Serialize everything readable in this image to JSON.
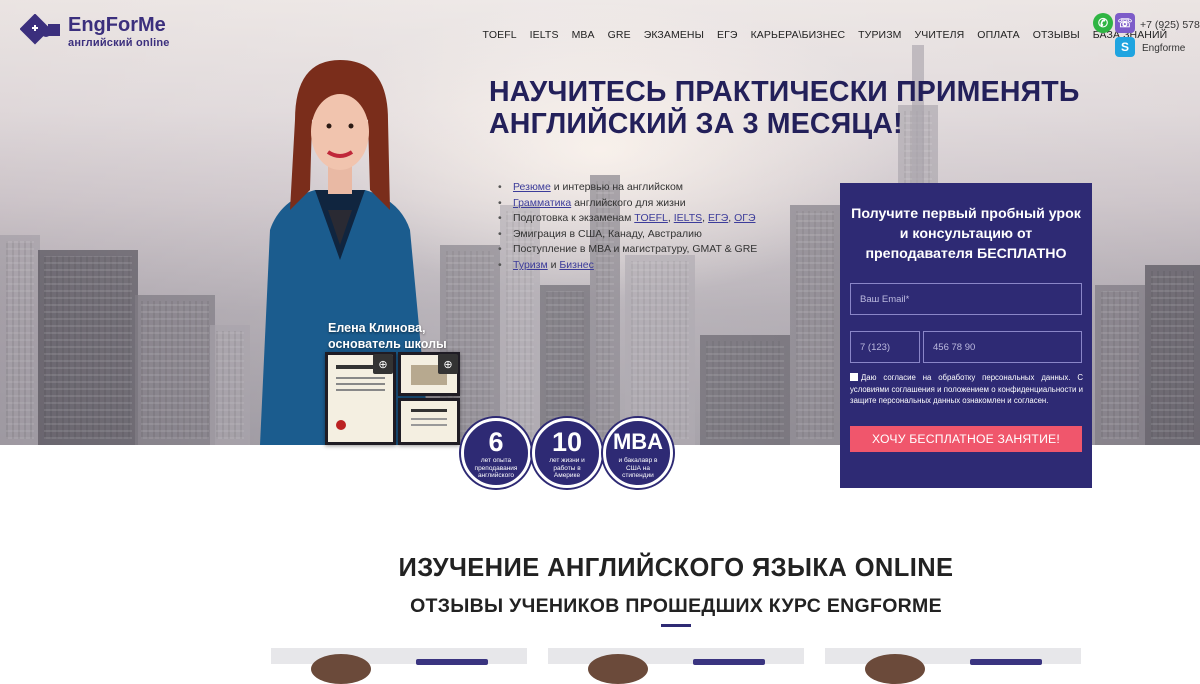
{
  "brand": {
    "name": "EngForMe",
    "tagline": "английский online"
  },
  "nav": [
    "TOEFL",
    "IELTS",
    "MBA",
    "GRE",
    "ЭКЗАМЕНЫ",
    "ЕГЭ",
    "КАРЬЕРА\\БИЗНЕС",
    "ТУРИЗМ",
    "УЧИТЕЛЯ",
    "ОПЛАТА",
    "ОТЗЫВЫ",
    "БАЗА ЗНАНИЙ"
  ],
  "contacts": {
    "phone": "+7 (925) 578",
    "skype": "Engforme",
    "icons": [
      "whatsapp-icon",
      "viber-icon",
      "skype-icon"
    ]
  },
  "hero": {
    "headline_line1": "НАУЧИТЕСЬ ПРАКТИЧЕСКИ ПРИМЕНЯТЬ",
    "headline_line2": "АНГЛИЙСКИЙ ЗА 3 МЕСЯЦА!",
    "bullets": [
      {
        "link": "Резюме",
        "text": " и интервью на английском"
      },
      {
        "link": "Грамматика",
        "text": " английского для жизни"
      },
      {
        "text": "Подготовка к экзаменам ",
        "links": [
          "TOEFL",
          ", ",
          "IELTS",
          ", ",
          "ЕГЭ",
          ", ",
          "ОГЭ"
        ]
      },
      {
        "text": "Эмиграция в США, Канаду, Австралию"
      },
      {
        "text": "Поступление в MBA и магистратуру, GMAT & GRE"
      },
      {
        "link": "Туризм",
        "text": " и ",
        "link2": "Бизнес"
      }
    ],
    "founder_name": "Елена Клинова,",
    "founder_role": "основатель школы"
  },
  "badges": [
    {
      "big": "6",
      "small": "лет опыта преподавания английского"
    },
    {
      "big": "10",
      "small": "лет жизни и работы в Америке"
    },
    {
      "big": "MBA",
      "small": "и бакалавр в США на стипендии"
    }
  ],
  "form": {
    "title": "Получите первый пробный урок и консультацию от преподавателя БЕСПЛАТНО",
    "email_placeholder": "Ваш Email*",
    "code_placeholder": "7 (123)",
    "phone_placeholder": "456 78 90",
    "agreement": "Даю согласие на обработку персональных данных. С условиями соглашения и положением о конфиденциальности и защите персональных данных ознакомлен и согласен.",
    "cta": "ХОЧУ БЕСПЛАТНОЕ ЗАНЯТИЕ!"
  },
  "section": {
    "title": "ИЗУЧЕНИЕ АНГЛИЙСКОГО ЯЗЫКА ONLINE",
    "subtitle": "ОТЗЫВЫ УЧЕНИКОВ ПРОШЕДШИХ КУРС ENGFORME"
  },
  "colors": {
    "brand": "#2e2a74",
    "cta": "#f0566c",
    "headline": "#23205a"
  }
}
